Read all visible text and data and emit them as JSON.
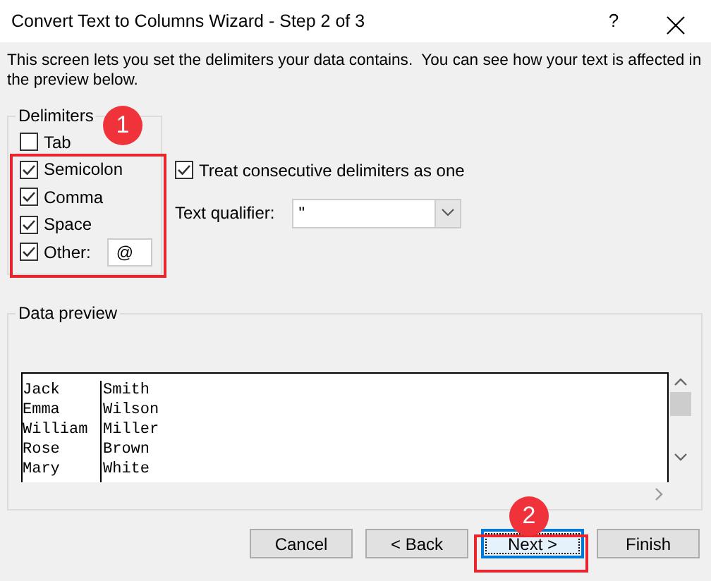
{
  "window": {
    "title": "Convert Text to Columns Wizard - Step 2 of 3",
    "help": "?"
  },
  "instructions": "This screen lets you set the delimiters your data contains.  You can see how your text is affected in the preview below.",
  "delimiters": {
    "title": "Delimiters",
    "options": [
      {
        "label": "Tab",
        "checked": false
      },
      {
        "label": "Semicolon",
        "checked": true
      },
      {
        "label": "Comma",
        "checked": true
      },
      {
        "label": "Space",
        "checked": true
      },
      {
        "label": "Other:",
        "checked": true,
        "value": "@"
      }
    ]
  },
  "treat_consecutive": {
    "label": "Treat consecutive delimiters as one",
    "checked": true
  },
  "text_qualifier": {
    "label": "Text qualifier:",
    "value": "\""
  },
  "data_preview": {
    "title": "Data preview",
    "rows": [
      [
        "Jack",
        "Smith"
      ],
      [
        "Emma",
        "Wilson"
      ],
      [
        "William",
        "Miller"
      ],
      [
        "Rose",
        "Brown"
      ],
      [
        "Mary",
        "White"
      ]
    ]
  },
  "buttons": [
    {
      "label": "Cancel",
      "default": false
    },
    {
      "label": "< Back",
      "default": false
    },
    {
      "label": "Next >",
      "default": true
    },
    {
      "label": "Finish",
      "default": false
    }
  ],
  "annotations": [
    {
      "label": "1"
    },
    {
      "label": "2"
    }
  ]
}
